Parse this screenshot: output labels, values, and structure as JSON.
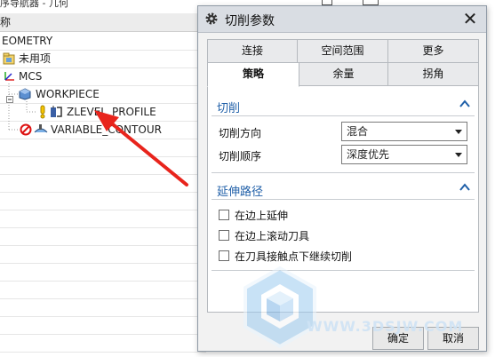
{
  "navigator": {
    "title_fragment": "序导航器 - 几何",
    "column_header": "称",
    "rows": [
      {
        "label": "EOMETRY"
      },
      {
        "label": "未用项"
      },
      {
        "label": "MCS"
      },
      {
        "label": "WORKPIECE"
      },
      {
        "label": "ZLEVEL_PROFILE"
      },
      {
        "label": "VARIABLE_CONTOUR"
      }
    ]
  },
  "dialog": {
    "title": "切削参数",
    "close_symbol": "✕",
    "tabs_row1": [
      "连接",
      "空间范围",
      "更多"
    ],
    "tabs_row2": [
      "策略",
      "余量",
      "拐角"
    ],
    "active_tab": "策略",
    "sections": {
      "cutting": {
        "title": "切削",
        "fields": [
          {
            "label": "切削方向",
            "value": "混合"
          },
          {
            "label": "切削顺序",
            "value": "深度优先"
          }
        ]
      },
      "extend_path": {
        "title": "延伸路径",
        "checkboxes": [
          {
            "label": "在边上延伸",
            "checked": false
          },
          {
            "label": "在边上滚动刀具",
            "checked": false
          },
          {
            "label": "在刀具接触点下继续切削",
            "checked": false
          }
        ]
      }
    },
    "ok_label": "确定",
    "cancel_label": "取消"
  },
  "watermark": {
    "text": "WWW.3DSJW.COM"
  },
  "colors": {
    "section_title": "#1f5fa8",
    "annotation_arrow": "#e8241c",
    "title_bar": "#d9dde3"
  }
}
